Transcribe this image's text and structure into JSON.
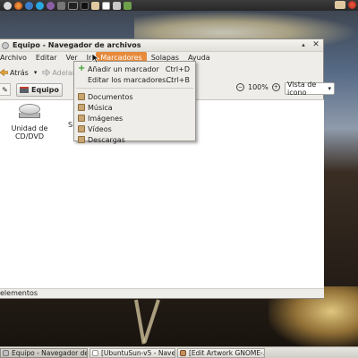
{
  "window": {
    "title": "Equipo - Navegador de archivos",
    "buttons": {
      "close": "✕"
    }
  },
  "menubar": {
    "items": [
      "Archivo",
      "Editar",
      "Ver",
      "Ir",
      "Marcadores",
      "Solapas",
      "Ayuda"
    ],
    "active_index": 4
  },
  "toolbar": {
    "back_label": "Atrás",
    "forward_label": "Adelante"
  },
  "location": {
    "path_button": "Equipo",
    "zoom": "100%",
    "view_mode": "Vista de icono"
  },
  "content": {
    "items": [
      {
        "label": "Unidad de CD/DVD",
        "icon": "optical-drive-icon"
      },
      {
        "label": "Si"
      }
    ]
  },
  "statusbar": {
    "text": "elementos"
  },
  "bookmarks_menu": {
    "add_bookmark": {
      "label": "Añadir un marcador",
      "accel": "Ctrl+D"
    },
    "edit_bookmarks": {
      "label": "Editar los marcadores…",
      "accel": "Ctrl+B"
    },
    "places": [
      {
        "label": "Documentos",
        "icon": "folder-icon"
      },
      {
        "label": "Música",
        "icon": "music-folder-icon"
      },
      {
        "label": "Imágenes",
        "icon": "pictures-folder-icon"
      },
      {
        "label": "Vídeos",
        "icon": "videos-folder-icon"
      },
      {
        "label": "Descargas",
        "icon": "downloads-folder-icon"
      }
    ]
  },
  "taskbar": {
    "tasks": [
      {
        "label": "Equipo - Navegador de...",
        "active": true
      },
      {
        "label": "[UbuntuSun-v5 - Nave...",
        "active": false
      },
      {
        "label": "[Edit Artwork GNOME-...",
        "active": false
      }
    ]
  },
  "colors": {
    "menu_highlight": "#e88a3a",
    "panel": "#2f2f2f",
    "window_bg": "#eeede9"
  }
}
